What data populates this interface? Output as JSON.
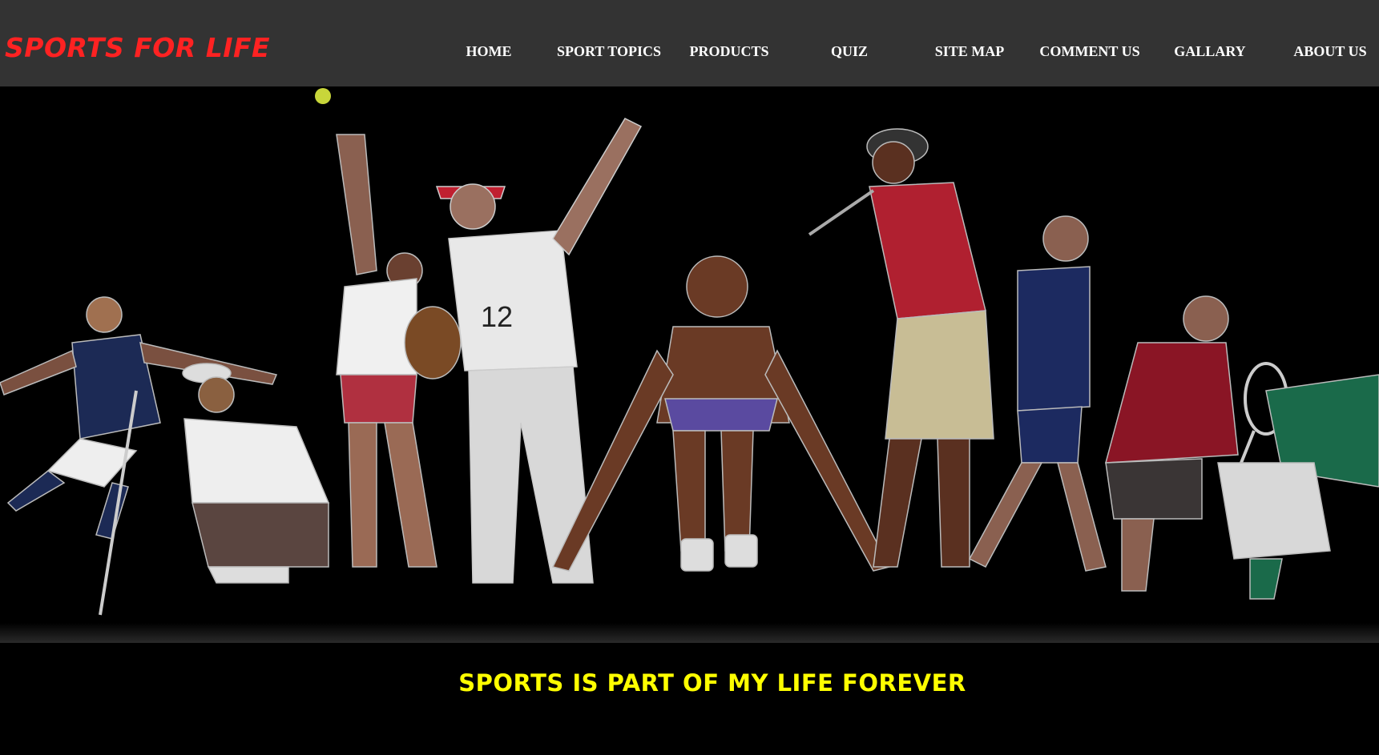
{
  "header": {
    "logo_text": "SPORTS FOR LIFE",
    "logo_color": "#ff2222",
    "background": "#333333"
  },
  "nav": {
    "items": [
      {
        "label": "HOME"
      },
      {
        "label": "SPORT TOPICS"
      },
      {
        "label": "PRODUCTS"
      },
      {
        "label": "QUIZ"
      },
      {
        "label": "SITE MAP"
      },
      {
        "label": "COMMENT US"
      },
      {
        "label": "GALLARY"
      },
      {
        "label": "ABOUT US"
      }
    ]
  },
  "hero": {
    "tagline": "SPORTS IS PART OF MY LIFE FOREVER",
    "tagline_color": "#ffff00"
  }
}
